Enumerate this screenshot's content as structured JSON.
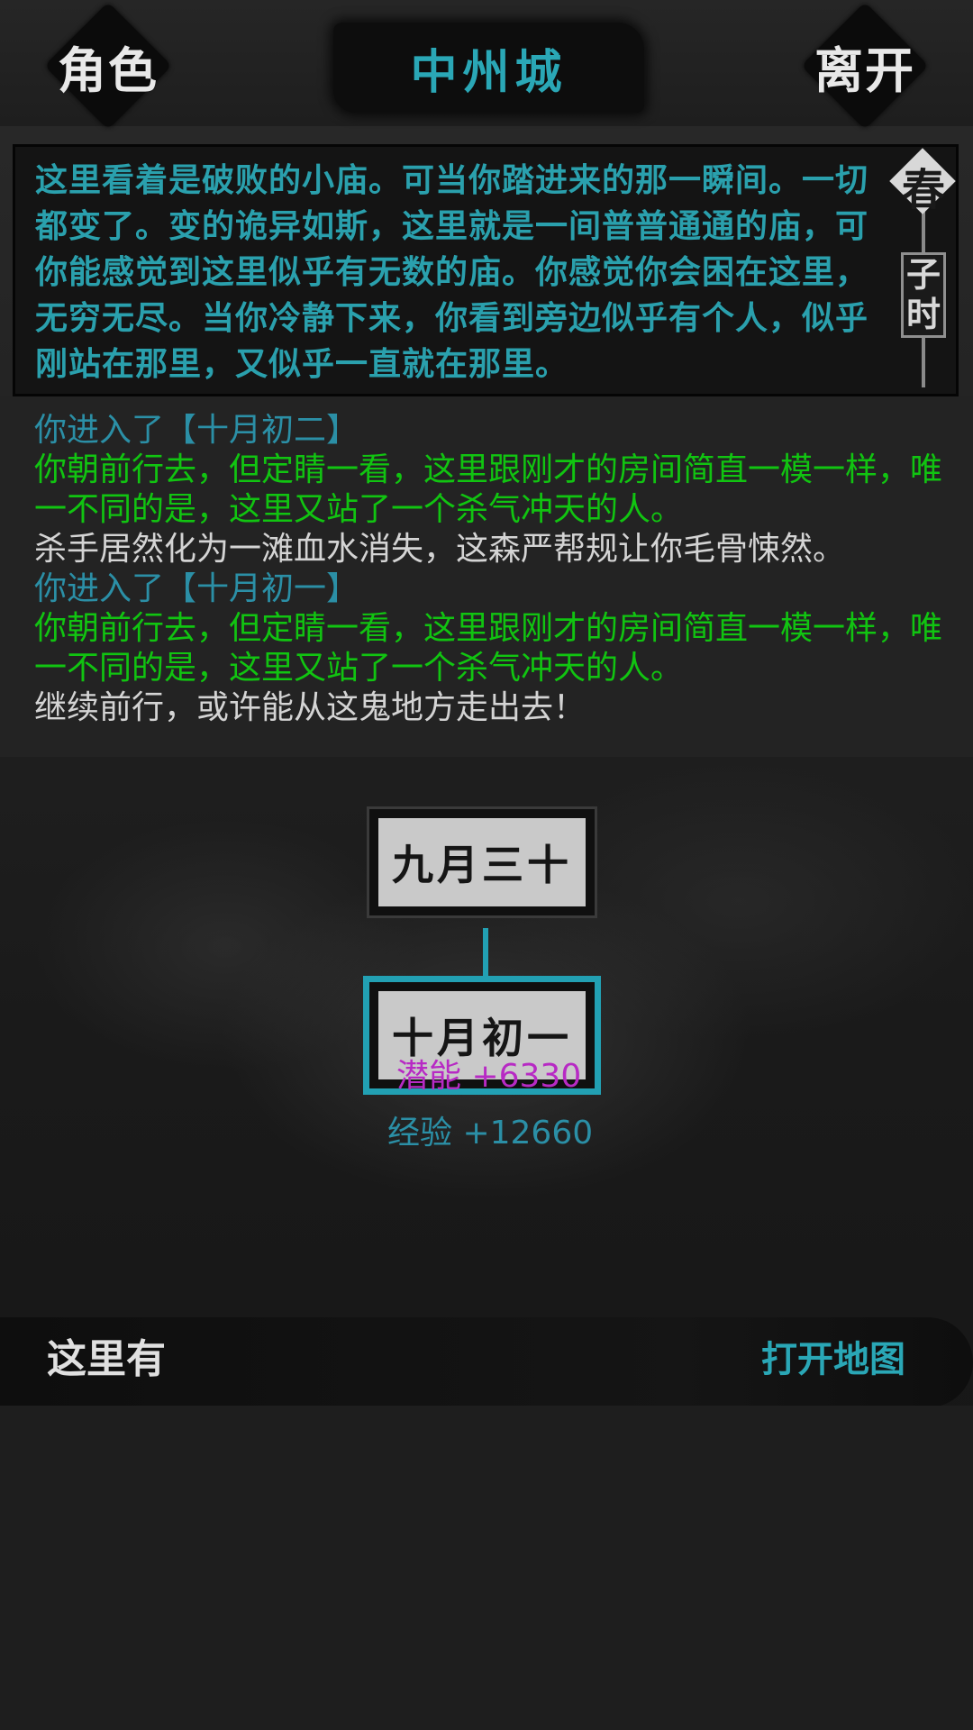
{
  "header": {
    "left_button": "角色",
    "title": "中州城",
    "right_button": "离开"
  },
  "description": "这里看着是破败的小庙。可当你踏进来的那一瞬间。一切都变了。变的诡异如斯，这里就是一间普普通通的庙，可你能感觉到这里似乎有无数的庙。你感觉你会困在这里，无穷无尽。当你冷静下来，你看到旁边似乎有个人，似乎刚站在那里，又似乎一直就在那里。",
  "season": {
    "season": "春",
    "time": "子时"
  },
  "log": [
    "你进入了【十月初二】",
    "你朝前行去，但定睛一看，这里跟刚才的房间简直一模一样，唯一不同的是，这里又站了一个杀气冲天的人。",
    "杀手居然化为一滩血水消失，这森严帮规让你毛骨悚然。",
    "你进入了【十月初一】",
    "你朝前行去，但定睛一看，这里跟刚才的房间简直一模一样，唯一不同的是，这里又站了一个杀气冲天的人。",
    "继续前行，或许能从这鬼地方走出去！"
  ],
  "map": {
    "prev_node": "九月三十",
    "current_node": "十月初一",
    "reward_potential": "潜能 +6330",
    "reward_exp": "经验 +12660"
  },
  "bottom": {
    "here_label": "这里有",
    "open_map": "打开地图"
  },
  "colors": {
    "accent": "#22a0b3",
    "log_cyan": "#2b8fa6",
    "log_green": "#11c411",
    "potential": "#b72ac4"
  }
}
